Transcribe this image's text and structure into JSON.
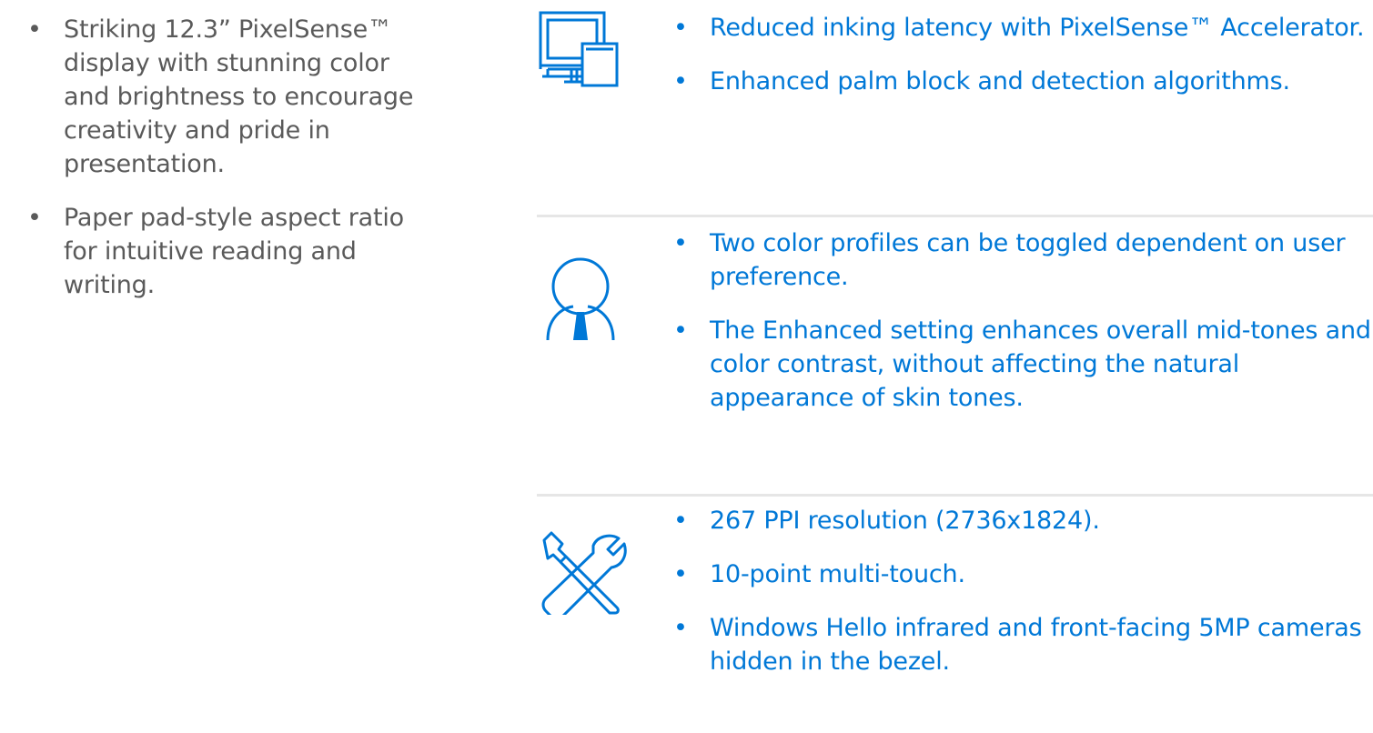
{
  "left_bullets": [
    "Striking 12.3” PixelSense™ display with stunning color and brightness to encourage creativity and pride in presentation.",
    "Paper pad-style aspect ratio for intuitive reading and writing."
  ],
  "sections": [
    {
      "icon": "devices-icon",
      "bullets": [
        "Reduced inking latency with PixelSense™ Accelerator.",
        "Enhanced palm block and detection algorithms."
      ]
    },
    {
      "icon": "user-icon",
      "bullets": [
        "Two color profiles can be toggled dependent on user preference.",
        "The Enhanced setting enhances overall mid-tones and color contrast, without affecting the natural appearance of skin tones."
      ]
    },
    {
      "icon": "tools-icon",
      "bullets": [
        "267 PPI resolution (2736x1824).",
        "10-point multi-touch.",
        "Windows Hello infrared and front-facing 5MP cameras hidden in the bezel."
      ]
    }
  ],
  "colors": {
    "accent": "#0078d7",
    "body_text": "#5a5a5a",
    "divider": "#e6e6e6"
  }
}
